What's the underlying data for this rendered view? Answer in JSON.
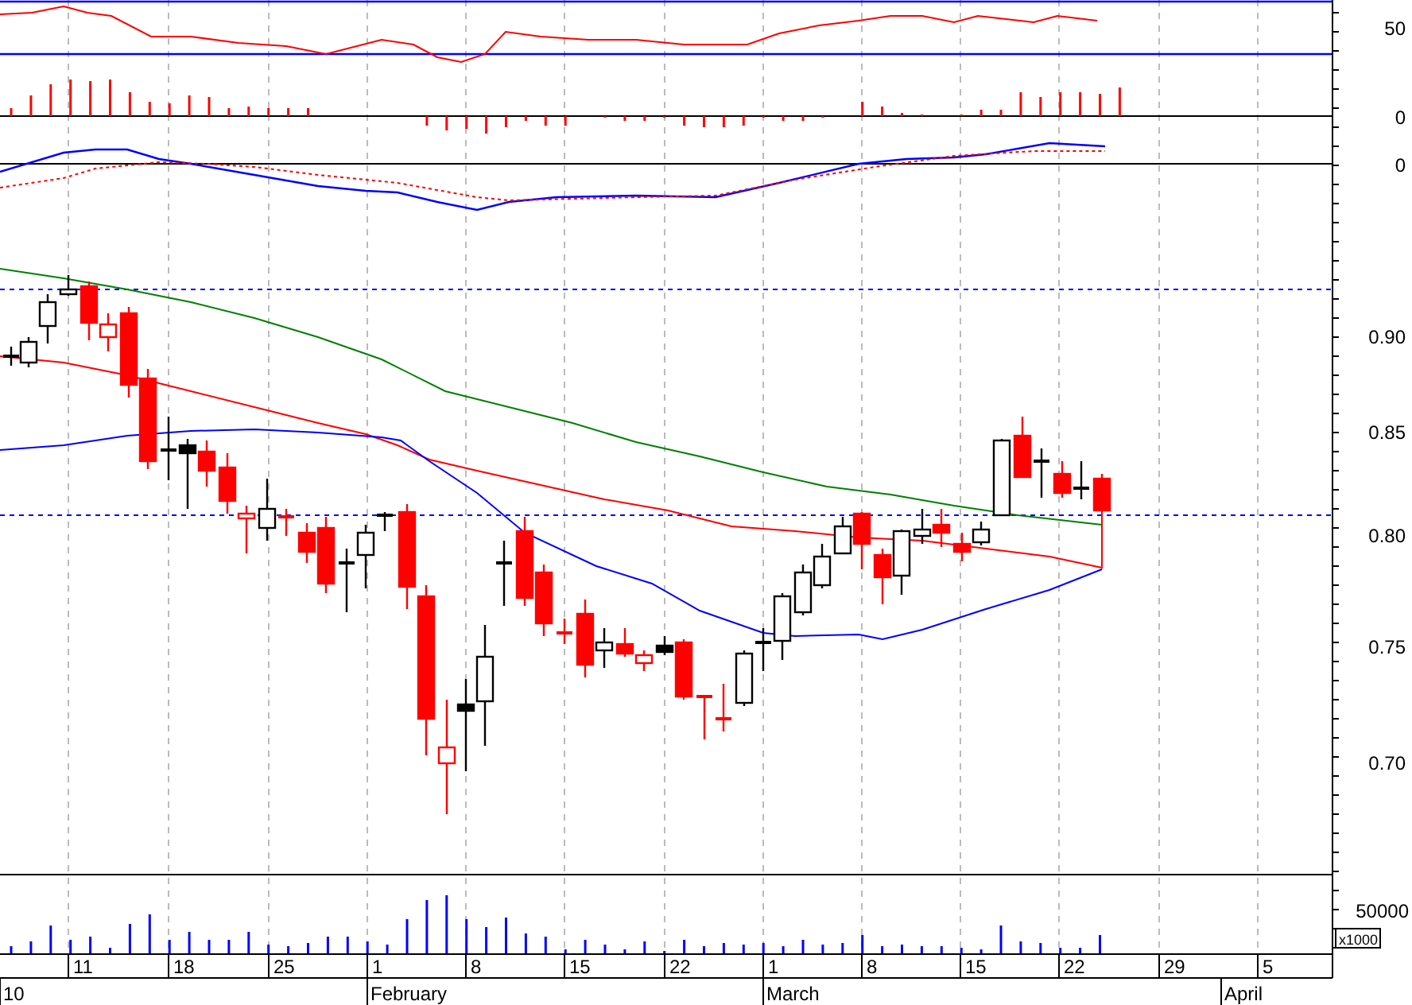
{
  "indicator_axis": {
    "labels": [
      "50",
      "0",
      "0"
    ]
  },
  "price_axis": {
    "labels": [
      "0.90",
      "0.85",
      "0.80",
      "0.75",
      "0.70"
    ]
  },
  "volume_axis": {
    "label": "50000",
    "unit": "x1000"
  },
  "date_axis": {
    "days": [
      "11",
      "18",
      "25",
      "1",
      "8",
      "15",
      "22",
      "1",
      "8",
      "15",
      "22",
      "29",
      "5"
    ],
    "months": [
      "10",
      "February",
      "March",
      "April"
    ]
  }
}
